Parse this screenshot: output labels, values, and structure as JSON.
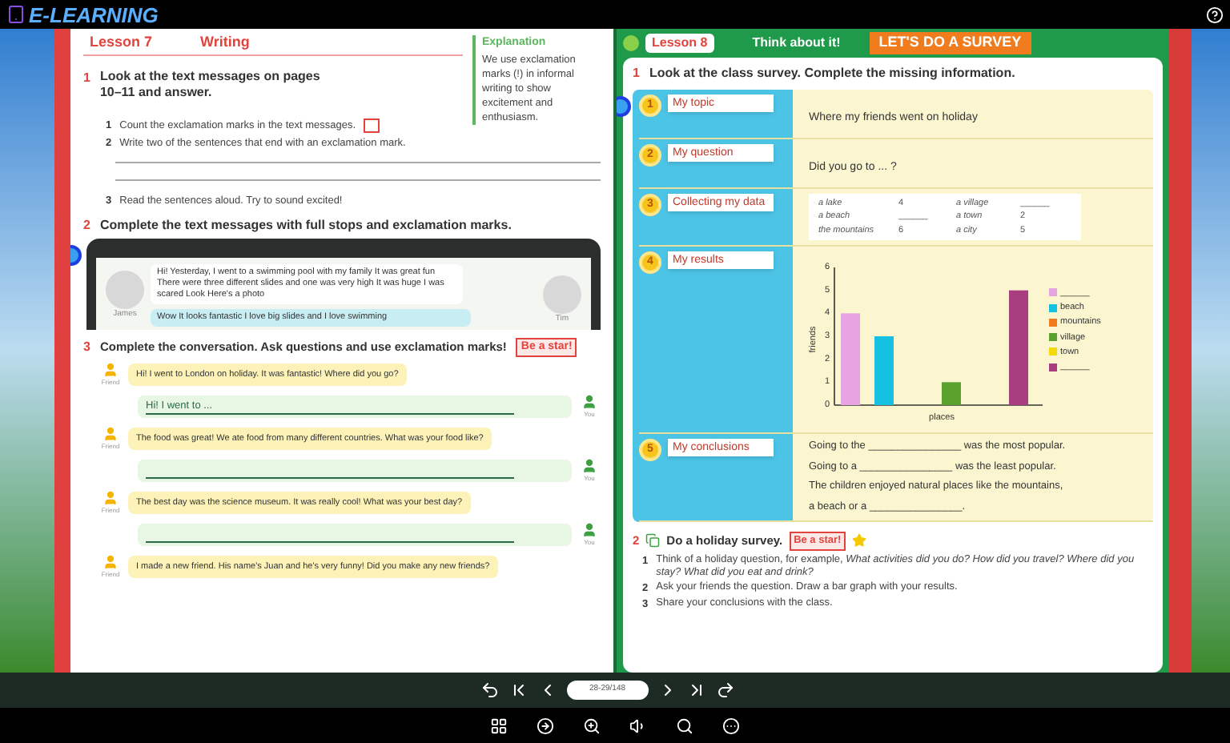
{
  "app": {
    "logo": "E-LEARNING"
  },
  "left_page": {
    "lesson": "Lesson 7",
    "title": "Writing",
    "explanation": {
      "heading": "Explanation",
      "text": "We use exclamation marks (!) in informal writing to show excitement and enthusiasm."
    },
    "exercise_1": {
      "number": "1",
      "instruction": "Look at the text messages on pages 10–11 and answer.",
      "items": [
        {
          "number": "1",
          "text": "Count the exclamation marks in the text messages.",
          "kind": "box"
        },
        {
          "number": "2",
          "text": "Write two of the sentences that end with an exclamation mark.",
          "kind": "lines"
        },
        {
          "number": "3",
          "text": "Read the sentences aloud. Try to sound excited!",
          "kind": "plain"
        }
      ]
    },
    "exercise_2": {
      "number": "2",
      "instruction": "Complete the text messages with full stops and exclamation marks.",
      "messages": [
        {
          "name": "James",
          "text": "Hi! Yesterday, I went to a swimming pool with my family  It was great fun  There were three different slides and one was very high  It was huge  I was scared  Look  Here's a photo"
        },
        {
          "name": "Tim",
          "text": "Wow  It looks fantastic  I love big slides and I love swimming"
        }
      ]
    },
    "exercise_3": {
      "number": "3",
      "instruction": "Complete the conversation. Ask questions and use exclamation marks!",
      "badge": "Be a star!",
      "chat": [
        {
          "kind": "friend",
          "sender": "Friend",
          "text": "Hi! I went to London on holiday. It was fantastic! Where did you go?"
        },
        {
          "kind": "you",
          "sender": "You",
          "text": "Hi! I went to ..."
        },
        {
          "kind": "friend",
          "sender": "Friend",
          "text": "The food was great! We ate food from many different countries. What was your food like?"
        },
        {
          "kind": "you",
          "sender": "You"
        },
        {
          "kind": "friend",
          "sender": "Friend",
          "text": "The best day was the science museum. It was really cool! What was your best day?"
        },
        {
          "kind": "you",
          "sender": "You"
        },
        {
          "kind": "friend",
          "sender": "Friend",
          "text": "I made a new friend. His name's Juan and he's very funny! Did you make any new friends?"
        }
      ]
    }
  },
  "right_page": {
    "lesson": "Lesson 8",
    "subtitle": "Think about it!",
    "banner": "LET'S DO A SURVEY",
    "exercise_1": {
      "number": "1",
      "instruction": "Look at the class survey. Complete the missing information.",
      "steps": [
        {
          "number": "1",
          "label": "My topic",
          "kind": "text",
          "text": "Where my friends went on holiday"
        },
        {
          "number": "2",
          "label": "My question",
          "kind": "text",
          "text": "Did you go to ... ?"
        },
        {
          "number": "3",
          "label": "Collecting my data",
          "kind": "table",
          "rows": [
            [
              "a lake",
              "4",
              "a village",
              "______"
            ],
            [
              "a beach",
              "______",
              "a town",
              "2"
            ],
            [
              "the mountains",
              "6",
              "a city",
              "5"
            ]
          ]
        },
        {
          "number": "4",
          "label": "My results",
          "kind": "chart",
          "chart_data": {
            "type": "bar",
            "legend": true,
            "xlabel": "places",
            "ylabel": "friends",
            "ylim": [
              0,
              6
            ],
            "yticks": [
              0,
              1,
              2,
              3,
              4,
              5,
              6
            ],
            "series": [
              {
                "name": "______",
                "color": "#e6a5e0",
                "values": [
                  4
                ]
              },
              {
                "name": "beach",
                "color": "#16c0e0",
                "values": [
                  3
                ]
              },
              {
                "name": "mountains",
                "color": "#f07c1e",
                "values": [
                  0
                ]
              },
              {
                "name": "village",
                "color": "#5aa02c",
                "values": [
                  1
                ]
              },
              {
                "name": "town",
                "color": "#f5d90a",
                "values": [
                  0
                ]
              },
              {
                "name": "______",
                "color": "#a83d80",
                "values": [
                  5
                ]
              }
            ]
          }
        },
        {
          "number": "5",
          "label": "My conclusions",
          "kind": "lines",
          "lines": [
            "Going to the ________________ was the most popular.",
            "Going to a ________________ was the least popular.",
            "The children enjoyed natural places like the mountains,",
            "a beach or a ________________."
          ]
        }
      ]
    },
    "exercise_2": {
      "number": "2",
      "instruction": "Do a holiday survey.",
      "badge": "Be a star!",
      "items": [
        {
          "number": "1",
          "text": "Think of a holiday question, for example, *What activities did you do? How did you travel? Where did you stay? What did you eat and drink?*"
        },
        {
          "number": "2",
          "text": "Ask your friends the question. Draw a bar graph with your results."
        },
        {
          "number": "3",
          "text": "Share your conclusions with the class."
        }
      ]
    }
  },
  "pager": {
    "page": "28-29/148"
  }
}
